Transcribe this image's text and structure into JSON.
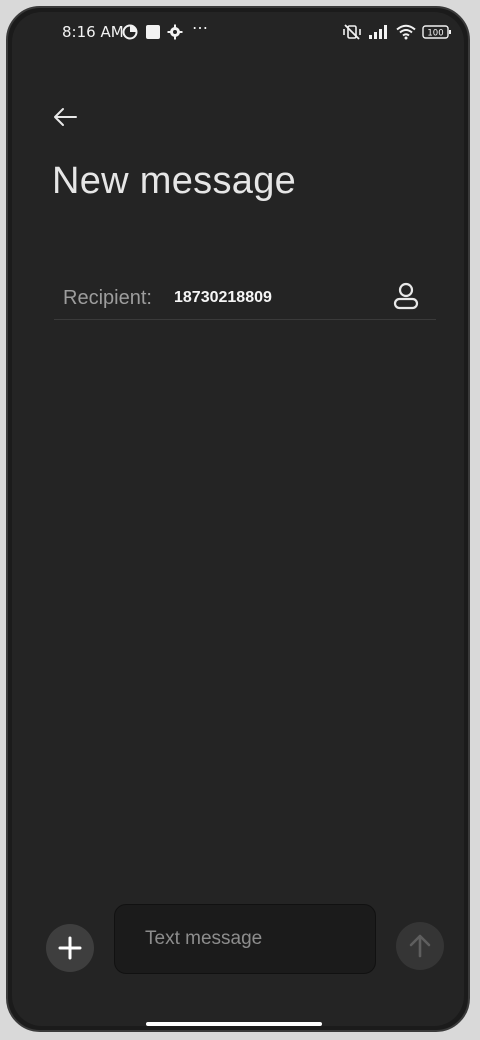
{
  "status_bar": {
    "time": "8:16 AM",
    "overflow": "⋯",
    "battery": "100",
    "icons": [
      "data-saver-icon",
      "square-icon",
      "settings-icon",
      "vibrate-off-icon",
      "signal-icon",
      "wifi-icon",
      "battery-icon"
    ]
  },
  "header": {
    "back_icon": "arrow-left-icon",
    "title": "New message"
  },
  "recipient": {
    "label": "Recipient:",
    "value": "18730218809",
    "contact_icon": "person-icon"
  },
  "compose": {
    "placeholder": "Text message",
    "attach_icon": "plus-icon",
    "send_icon": "arrow-up-icon"
  },
  "colors": {
    "background": "#242424",
    "input_background": "#1b1b1b",
    "accent_button": "#3e3e3e",
    "send_button": "#353535",
    "text_primary": "#e6e6e6",
    "text_secondary": "#9d9d9d"
  }
}
